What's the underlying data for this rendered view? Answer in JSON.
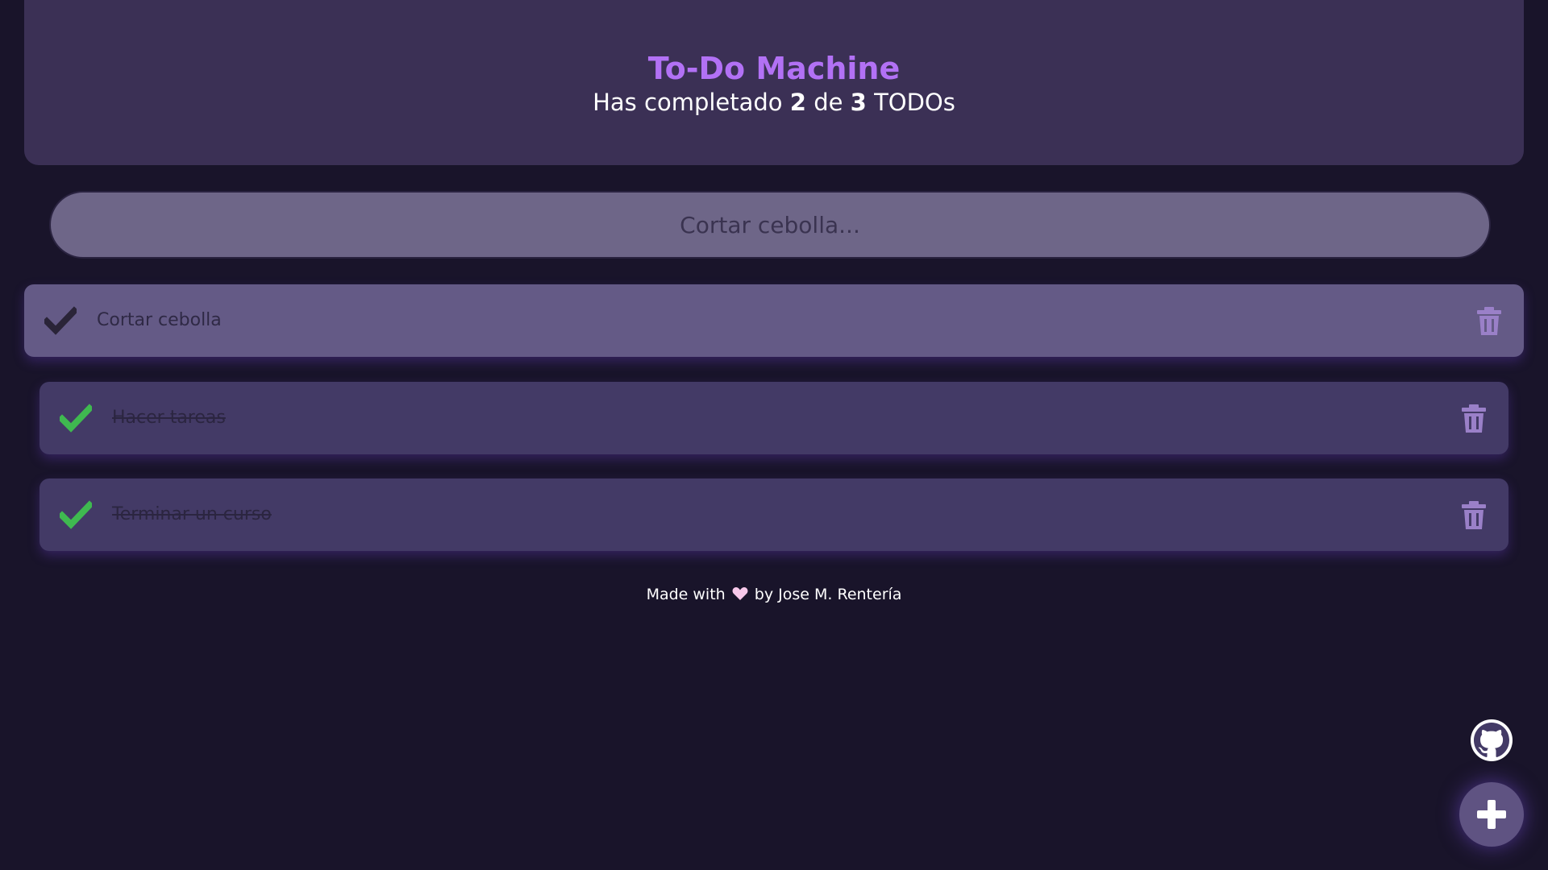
{
  "header": {
    "title": "To-Do Machine",
    "counter_prefix": "Has completado",
    "completed": "2",
    "counter_middle": "de",
    "total": "3",
    "counter_suffix": "TODOs"
  },
  "search": {
    "placeholder": "Cortar cebolla..."
  },
  "todos": [
    {
      "text": "Cortar cebolla",
      "completed": false
    },
    {
      "text": "Hacer tareas",
      "completed": true
    },
    {
      "text": "Terminar un curso",
      "completed": true
    }
  ],
  "footer": {
    "prefix": "Made with",
    "suffix": "by Jose M. Rentería"
  },
  "colors": {
    "background": "#19142a",
    "header": "#3b3055",
    "title": "#b271f5",
    "check_done": "#3fb950",
    "check_pending": "#2a2438",
    "delete_icon": "#9a80c8",
    "heart": "#f7c8ea"
  },
  "icons": {
    "check": "check-icon",
    "delete": "trash-icon",
    "heart": "heart-icon",
    "github": "github-icon",
    "add": "plus-icon"
  }
}
